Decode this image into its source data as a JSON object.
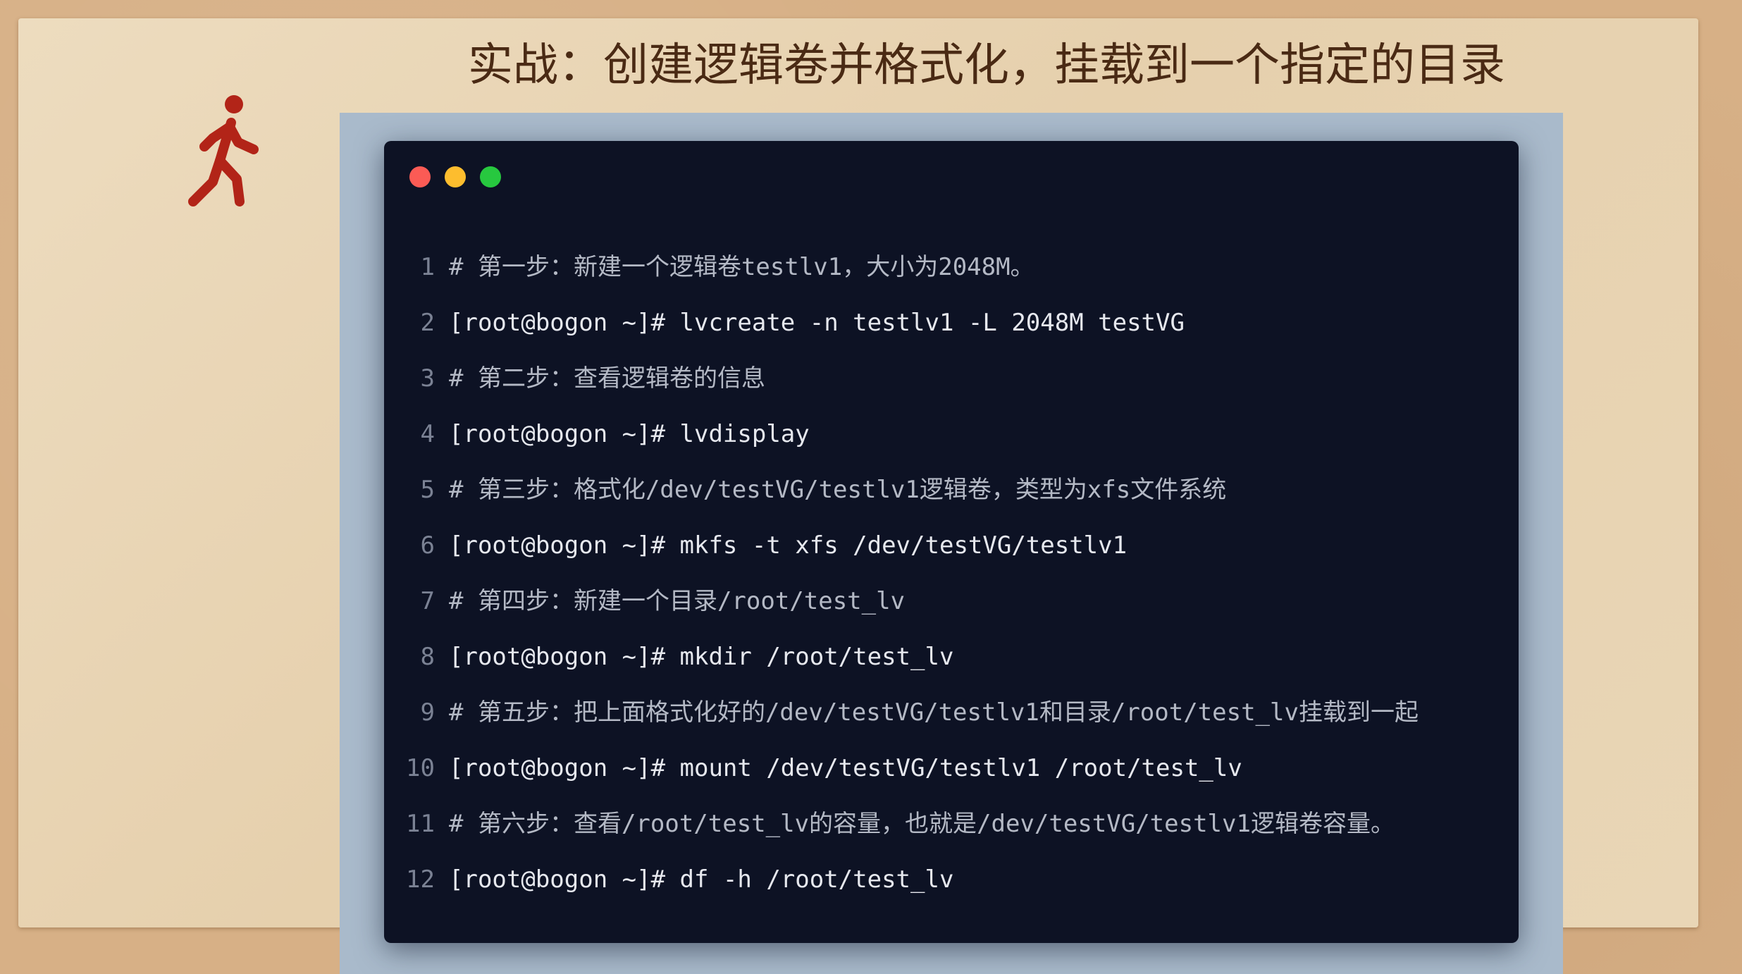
{
  "slide": {
    "title": "实战：创建逻辑卷并格式化，挂载到一个指定的目录",
    "icon": "walking-person-icon",
    "icon_color": "#b22418"
  },
  "terminal": {
    "window_controls": [
      "close",
      "minimize",
      "maximize"
    ],
    "colors": {
      "background": "#0d1224",
      "close": "#fb5b55",
      "minimize": "#fdbd2e",
      "maximize": "#27c83f"
    },
    "lines": [
      {
        "n": "1",
        "type": "comment",
        "text": "# 第一步：新建一个逻辑卷testlv1，大小为2048M。"
      },
      {
        "n": "2",
        "type": "cmd",
        "text": "[root@bogon ~]# lvcreate -n testlv1 -L 2048M testVG"
      },
      {
        "n": "3",
        "type": "comment",
        "text": "# 第二步：查看逻辑卷的信息"
      },
      {
        "n": "4",
        "type": "cmd",
        "text": "[root@bogon ~]# lvdisplay"
      },
      {
        "n": "5",
        "type": "comment",
        "text": "# 第三步：格式化/dev/testVG/testlv1逻辑卷，类型为xfs文件系统"
      },
      {
        "n": "6",
        "type": "cmd",
        "text": "[root@bogon ~]# mkfs -t xfs /dev/testVG/testlv1"
      },
      {
        "n": "7",
        "type": "comment",
        "text": "# 第四步：新建一个目录/root/test_lv"
      },
      {
        "n": "8",
        "type": "cmd",
        "text": "[root@bogon ~]# mkdir /root/test_lv"
      },
      {
        "n": "9",
        "type": "comment",
        "text": "# 第五步：把上面格式化好的/dev/testVG/testlv1和目录/root/test_lv挂载到一起"
      },
      {
        "n": "10",
        "type": "cmd",
        "text": "[root@bogon ~]# mount /dev/testVG/testlv1 /root/test_lv"
      },
      {
        "n": "11",
        "type": "comment",
        "text": "# 第六步：查看/root/test_lv的容量，也就是/dev/testVG/testlv1逻辑卷容量。"
      },
      {
        "n": "12",
        "type": "cmd",
        "text": "[root@bogon ~]# df -h /root/test_lv"
      }
    ]
  }
}
